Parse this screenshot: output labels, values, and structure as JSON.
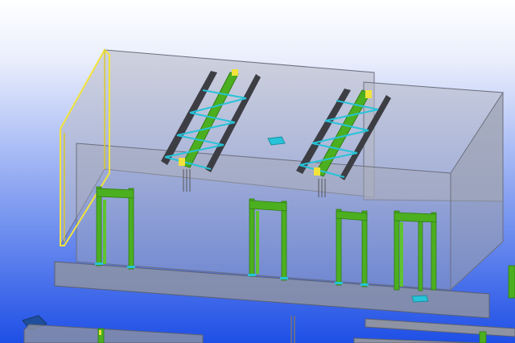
{
  "viewport": {
    "background_top": "#ffffff",
    "background_bottom": "#1e4fe6"
  },
  "colors": {
    "glass_fill": "#a3a7b4",
    "glass_edge": "#6b6f7e",
    "slab_fill": "#8e93a3",
    "member_green": "#4caf1f",
    "member_green_dark": "#2e7d12",
    "member_dark": "#3d3d44",
    "brace_cyan": "#27c3d8",
    "highlight_yellow": "#f2e33a",
    "magenta_edge": "#c060c0"
  }
}
